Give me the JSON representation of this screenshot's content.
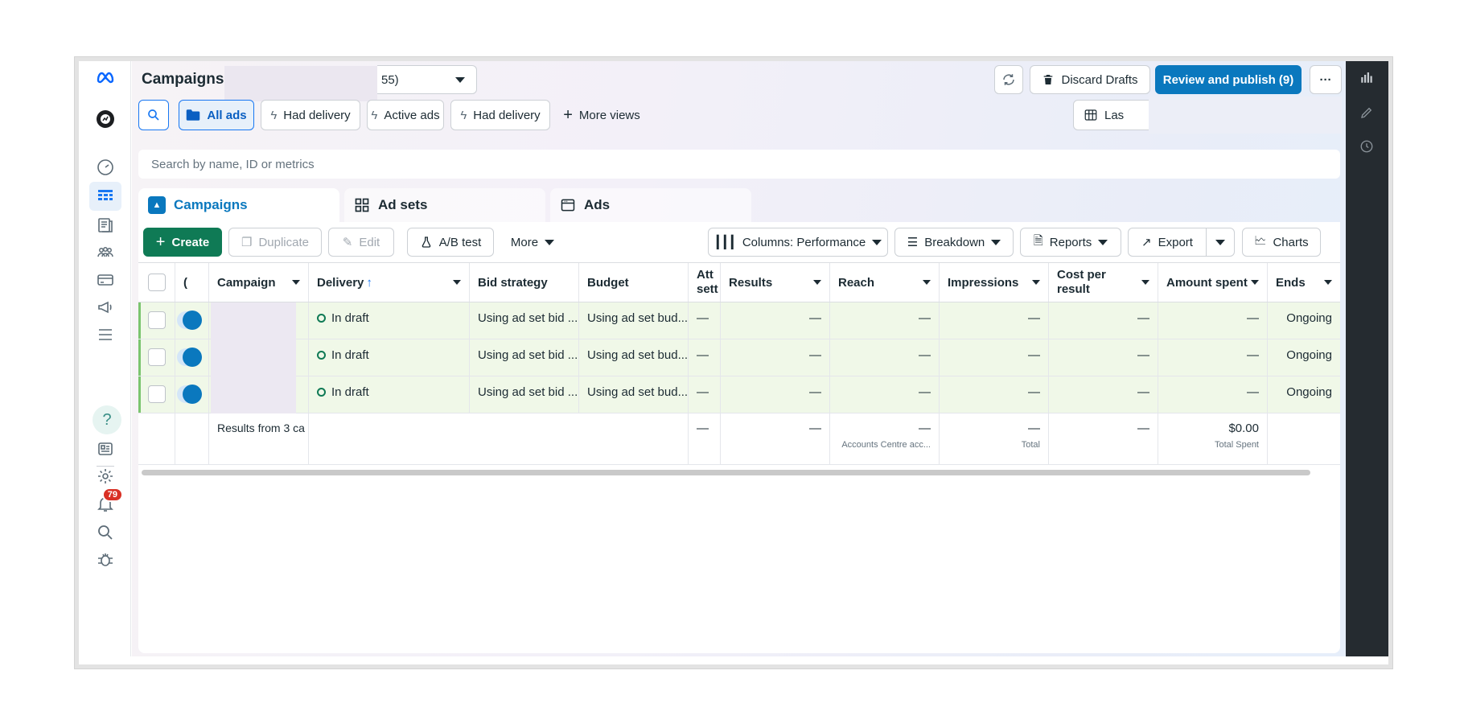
{
  "header": {
    "title": "Campaigns",
    "account_selector_value": "55)",
    "discard_label": "Discard Drafts",
    "publish_label": "Review and publish (9)",
    "more_label": "···"
  },
  "views": {
    "all_ads": "All ads",
    "had_delivery_1": "Had delivery",
    "active_ads": "Active ads",
    "had_delivery_2": "Had delivery",
    "more_views": "More views",
    "date_range": "Las"
  },
  "search": {
    "placeholder": "Search by name, ID or metrics"
  },
  "tabs": [
    {
      "label": "Campaigns"
    },
    {
      "label": "Ad sets"
    },
    {
      "label": "Ads"
    }
  ],
  "toolbar": {
    "create": "Create",
    "duplicate": "Duplicate",
    "edit": "Edit",
    "ab_test": "A/B test",
    "more": "More",
    "columns": "Columns: Performance",
    "breakdown": "Breakdown",
    "reports": "Reports",
    "export": "Export",
    "charts": "Charts"
  },
  "table": {
    "headers": {
      "offon": "(",
      "campaign": "Campaign",
      "delivery": "Delivery",
      "delivery_sort": "↑",
      "bid_strategy": "Bid strategy",
      "budget": "Budget",
      "attribution": "Att sett",
      "results": "Results",
      "reach": "Reach",
      "impressions": "Impressions",
      "cost_per_result": "Cost per result",
      "amount_spent": "Amount spent",
      "ends": "Ends"
    },
    "rows": [
      {
        "delivery": "In draft",
        "bid_strategy": "Using ad set bid ...",
        "budget": "Using ad set bud...",
        "attribution": "—",
        "results": "—",
        "reach": "—",
        "impressions": "—",
        "cost_per_result": "—",
        "amount_spent": "—",
        "ends": "Ongoing"
      },
      {
        "delivery": "In draft",
        "bid_strategy": "Using ad set bid ...",
        "budget": "Using ad set bud...",
        "attribution": "—",
        "results": "—",
        "reach": "—",
        "impressions": "—",
        "cost_per_result": "—",
        "amount_spent": "—",
        "ends": "Ongoing"
      },
      {
        "delivery": "In draft",
        "bid_strategy": "Using ad set bid ...",
        "budget": "Using ad set bud...",
        "attribution": "—",
        "results": "—",
        "reach": "—",
        "impressions": "—",
        "cost_per_result": "—",
        "amount_spent": "—",
        "ends": "Ongoing"
      }
    ],
    "summary": {
      "label": "Results from 3 ca",
      "attribution": "—",
      "results": "—",
      "reach": "—",
      "reach_sub": "Accounts Centre acc...",
      "impressions": "—",
      "impressions_sub": "Total",
      "cost_per_result": "—",
      "amount_spent": "$0.00",
      "amount_spent_sub": "Total Spent"
    }
  },
  "rail": {
    "notification_count": "79",
    "help_glyph": "?"
  },
  "colors": {
    "primary": "#0a78be",
    "create": "#0f7a55",
    "draft_row": "#f0f8e8",
    "badge": "#d93025"
  }
}
